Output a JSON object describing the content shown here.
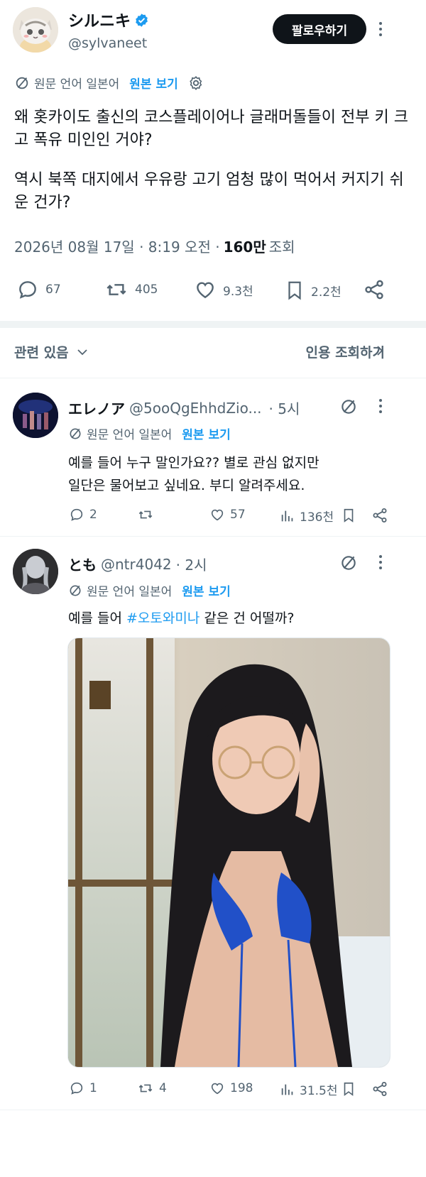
{
  "main_post": {
    "author_name": "シルニキ",
    "author_handle": "@sylvaneet",
    "follow_label": "팔로우하기",
    "translate_note": "원문 언어 일본어",
    "translate_link": "원본 보기",
    "paragraph1": "왜 홋카이도 출신의 코스플레이어나 글래머돌들이 전부 키 크고 폭유 미인인 거야?",
    "paragraph2": "역시 북쪽 대지에서 우유랑 고기 엄청 많이 먹어서 커지기 쉬운 건가?",
    "timestamp": "2026년 08월 17일 · 8:19 오전 ·",
    "views_count": "160만",
    "views_label": "조회",
    "actions": {
      "replies": "67",
      "reposts": "405",
      "likes": "9.3천",
      "bookmarks": "2.2천"
    }
  },
  "section": {
    "related_label": "관련 있음",
    "quotes_label": "인용 조회하기"
  },
  "replies": [
    {
      "name": "エレノア",
      "handle": "@5ooQgEhhdZio...",
      "time": "· 5시",
      "translate_note": "원문 언어 일본어",
      "translate_link": "원본 보기",
      "line1": "예를 들어 누구 말인가요?? 별로 관심 없지만",
      "line2": "일단은 물어보고 싶네요. 부디 알려주세요.",
      "actions": {
        "replies": "2",
        "reposts": "",
        "likes": "57",
        "views": "136천"
      }
    },
    {
      "name": "とも",
      "handle": "@ntr4042",
      "time": "· 2시",
      "translate_note": "원문 언어 일본어",
      "translate_link": "원본 보기",
      "text_before": "예를 들어 ",
      "hashtag": "#오토와미나",
      "text_after": " 같은 건 어떨까?",
      "actions": {
        "replies": "1",
        "reposts": "4",
        "likes": "198",
        "views": "31.5천"
      }
    }
  ],
  "colors": {
    "accent": "#1d9bf0",
    "text": "#0f1419",
    "muted": "#536471",
    "divider": "#eff3f4"
  }
}
